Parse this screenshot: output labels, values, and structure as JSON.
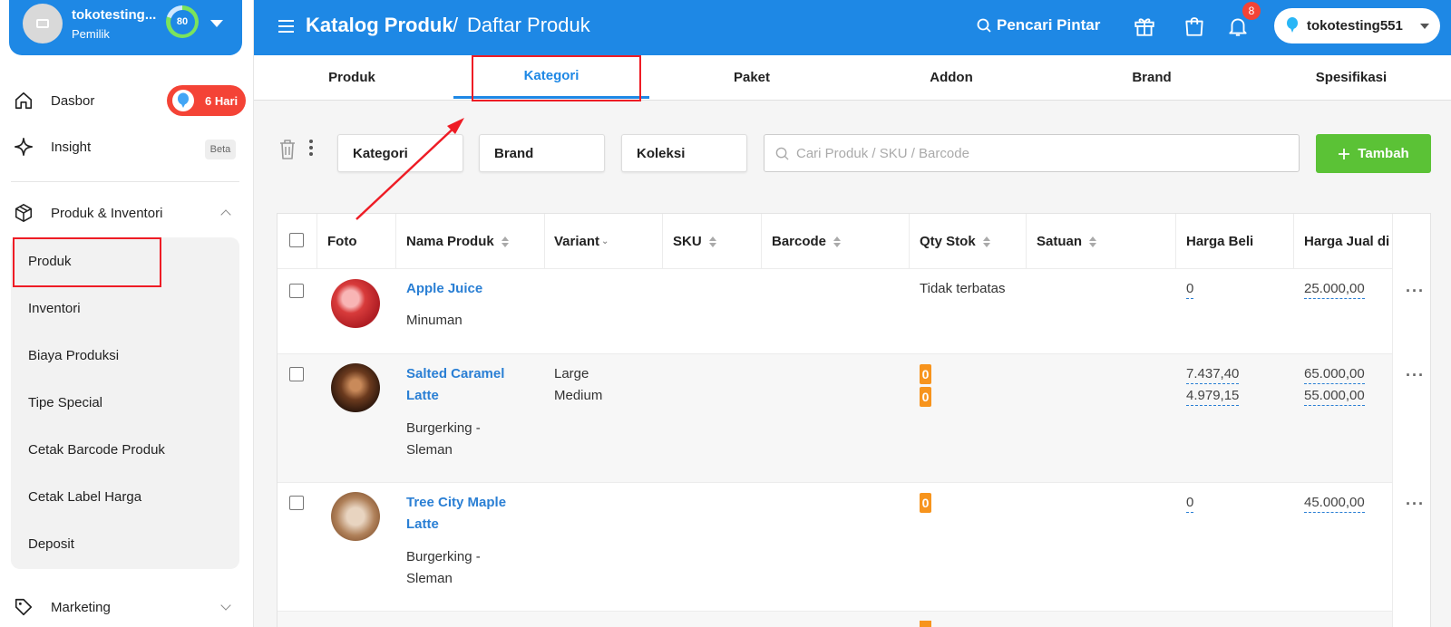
{
  "profile": {
    "store_name": "tokotesting...",
    "role": "Pemilik",
    "score": "80"
  },
  "sidebar": {
    "items": [
      {
        "label": "Dasbor",
        "icon": "home-icon"
      },
      {
        "label": "Insight",
        "icon": "sparkle-icon",
        "badge": "Beta"
      },
      {
        "label": "Produk & Inventori",
        "icon": "box-icon"
      },
      {
        "label": "Marketing",
        "icon": "tag-icon"
      }
    ],
    "trial_badge": "6 Hari",
    "submenu": [
      "Produk",
      "Inventori",
      "Biaya Produksi",
      "Tipe Special",
      "Cetak Barcode Produk",
      "Cetak Label Harga",
      "Deposit"
    ]
  },
  "header": {
    "title_main": "Katalog Produk",
    "separator": "/",
    "title_sub": "Daftar Produk",
    "smart_search": "Pencari Pintar",
    "notification_count": "8",
    "store_select": "tokotesting551"
  },
  "tabs": [
    {
      "label": "Produk",
      "active": false
    },
    {
      "label": "Kategori",
      "active": true
    },
    {
      "label": "Paket",
      "active": false
    },
    {
      "label": "Addon",
      "active": false
    },
    {
      "label": "Brand",
      "active": false
    },
    {
      "label": "Spesifikasi",
      "active": false
    }
  ],
  "toolbar": {
    "filters": [
      "Kategori",
      "Brand",
      "Koleksi"
    ],
    "search_placeholder": "Cari Produk / SKU / Barcode",
    "add_label": "Tambah"
  },
  "table": {
    "columns": [
      "Foto",
      "Nama Produk",
      "Variant",
      "SKU",
      "Barcode",
      "Qty Stok",
      "Satuan",
      "Harga Beli",
      "Harga Jual di"
    ],
    "rows": [
      {
        "name": "Apple Juice",
        "category": "Minuman",
        "variants": [],
        "qty_text": "Tidak terbatas",
        "qty": [],
        "buy": [
          "0"
        ],
        "sell": [
          "25.000,00"
        ]
      },
      {
        "name_line1": "Salted Caramel",
        "name_line2": "Latte",
        "category_line1": "Burgerking -",
        "category_line2": "Sleman",
        "variants": [
          "Large",
          "Medium"
        ],
        "qty": [
          "0",
          "0"
        ],
        "buy": [
          "7.437,40",
          "4.979,15"
        ],
        "sell": [
          "65.000,00",
          "55.000,00"
        ]
      },
      {
        "name_line1": "Tree City Maple",
        "name_line2": "Latte",
        "category_line1": "Burgerking -",
        "category_line2": "Sleman",
        "variants": [],
        "qty": [
          "0"
        ],
        "buy": [
          "0"
        ],
        "sell": [
          "45.000,00"
        ]
      }
    ]
  },
  "colors": {
    "primary": "#1e88e5",
    "success": "#5bc236",
    "danger": "#f44336",
    "stock_badge": "#f7941d",
    "annotation": "#ee1c25"
  }
}
